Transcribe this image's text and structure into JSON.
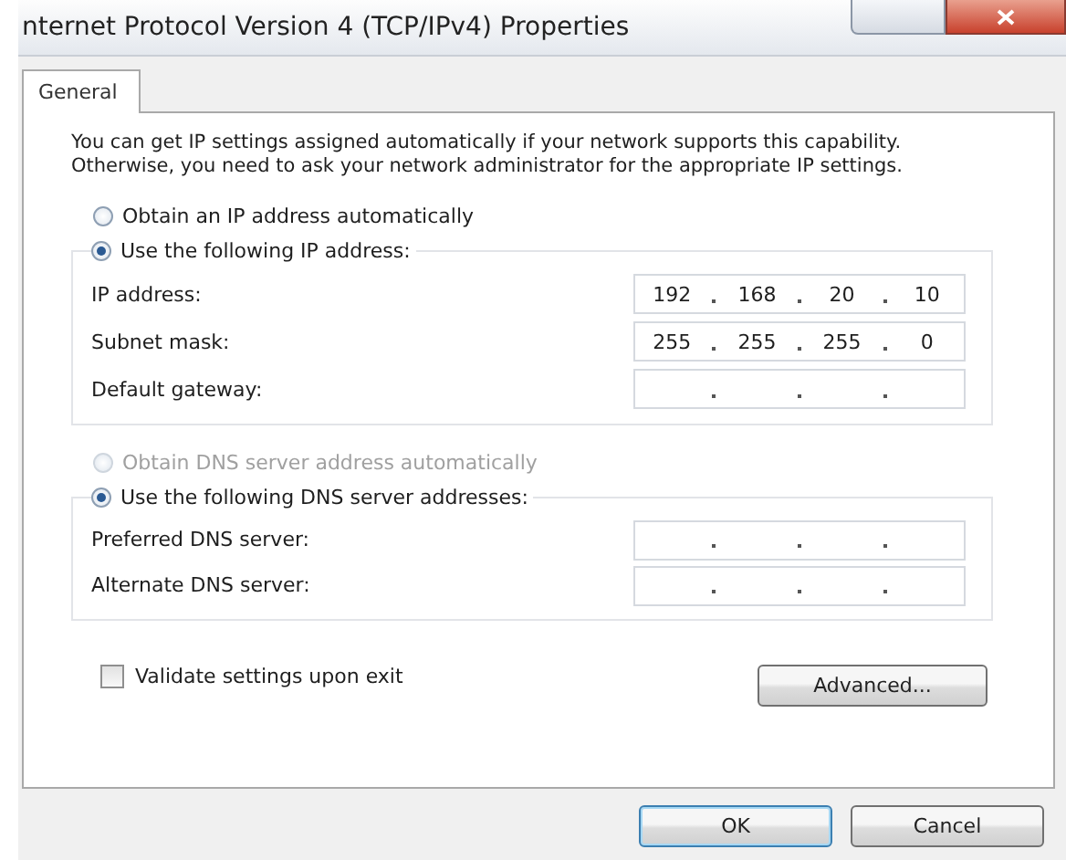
{
  "window": {
    "title": "nternet Protocol Version 4 (TCP/IPv4) Properties"
  },
  "tabs": [
    {
      "label": "General",
      "selected": true
    }
  ],
  "description": "You can get IP settings assigned automatically if your network supports this capability. Otherwise, you need to ask your network administrator for the appropriate IP settings.",
  "sections": [
    {
      "auto_option": {
        "label": "Obtain an IP address automatically",
        "selected": false,
        "disabled": false
      },
      "manual_option": {
        "label": "Use the following IP address:",
        "selected": true,
        "disabled": false
      },
      "fields": [
        {
          "label": "IP address:",
          "octets": [
            "192",
            "168",
            "20",
            "10"
          ]
        },
        {
          "label": "Subnet mask:",
          "octets": [
            "255",
            "255",
            "255",
            "0"
          ]
        },
        {
          "label": "Default gateway:"
        }
      ]
    },
    {
      "auto_option": {
        "label": "Obtain DNS server address automatically",
        "selected": false,
        "disabled": true
      },
      "manual_option": {
        "label": "Use the following DNS server addresses:",
        "selected": true,
        "disabled": false
      },
      "fields": [
        {
          "label": "Preferred DNS server:"
        },
        {
          "label": "Alternate DNS server:"
        }
      ]
    }
  ],
  "validate_checkbox": {
    "label": "Validate settings upon exit",
    "checked": false
  },
  "advanced_button": {
    "label": "Advanced..."
  },
  "buttons": [
    {
      "label": "OK",
      "default": true
    },
    {
      "label": "Cancel",
      "default": false
    }
  ]
}
